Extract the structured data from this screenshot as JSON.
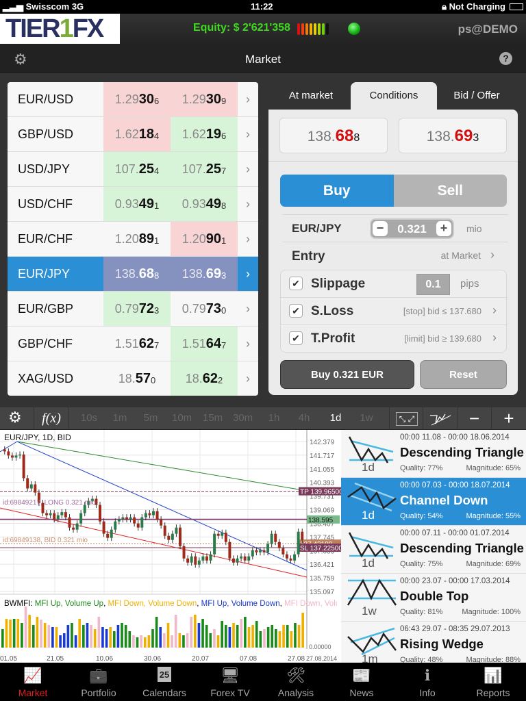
{
  "status": {
    "carrier": "Swisscom",
    "network": "3G",
    "time": "11:22",
    "battery": "Not Charging"
  },
  "header": {
    "logo": "TIER1FX",
    "equity": "Equity: $ 2'621'358",
    "user": "ps@DEMO",
    "meter_colors": [
      "#e01010",
      "#f04010",
      "#f07a10",
      "#f0b010",
      "#e0d010",
      "#b0d010",
      "#70d010",
      "#111"
    ],
    "connection": "connected"
  },
  "nav": {
    "title": "Market",
    "settings_icon": "gear-icon",
    "help_icon": "help-icon"
  },
  "quotes": [
    {
      "pair": "EUR/USD",
      "bid": [
        "1.29",
        "30",
        "6",
        "red"
      ],
      "ask": [
        "1.29",
        "30",
        "9",
        "red"
      ]
    },
    {
      "pair": "GBP/USD",
      "bid": [
        "1.62",
        "18",
        "4",
        "red"
      ],
      "ask": [
        "1.62",
        "19",
        "6",
        "green"
      ]
    },
    {
      "pair": "USD/JPY",
      "bid": [
        "107.",
        "25",
        "4",
        "green"
      ],
      "ask": [
        "107.",
        "25",
        "7",
        "green"
      ]
    },
    {
      "pair": "USD/CHF",
      "bid": [
        "0.93",
        "49",
        "1",
        "green"
      ],
      "ask": [
        "0.93",
        "49",
        "8",
        "green"
      ]
    },
    {
      "pair": "EUR/CHF",
      "bid": [
        "1.20",
        "89",
        "1",
        "none"
      ],
      "ask": [
        "1.20",
        "90",
        "1",
        "red"
      ]
    },
    {
      "pair": "EUR/JPY",
      "bid": [
        "138.",
        "68",
        "8",
        "sel"
      ],
      "ask": [
        "138.",
        "69",
        "3",
        "sel"
      ],
      "selected": true
    },
    {
      "pair": "EUR/GBP",
      "bid": [
        "0.79",
        "72",
        "3",
        "green"
      ],
      "ask": [
        "0.79",
        "73",
        "0",
        "none"
      ]
    },
    {
      "pair": "GBP/CHF",
      "bid": [
        "1.51",
        "62",
        "7",
        "none"
      ],
      "ask": [
        "1.51",
        "64",
        "7",
        "green"
      ]
    },
    {
      "pair": "XAG/USD",
      "bid": [
        "18.",
        "57",
        "0",
        "none"
      ],
      "ask": [
        "18.",
        "62",
        "2",
        "green"
      ]
    }
  ],
  "colors": {
    "red": "#f8d4d4",
    "green": "#d8f4d8",
    "none": "transparent",
    "sel": "#8592c0",
    "accent": "#2b8fd6"
  },
  "order": {
    "tabs": [
      "At market",
      "Conditions",
      "Bid / Offer"
    ],
    "active_tab": 1,
    "bid": {
      "pre": "138.",
      "big": "68",
      "sub": "8"
    },
    "ask": {
      "pre": "138.",
      "big": "69",
      "sub": "3"
    },
    "buy": "Buy",
    "sell": "Sell",
    "pair": "EUR/JPY",
    "amount": "0.321",
    "unit": "mio",
    "entry": "Entry",
    "entry_value": "at Market",
    "slippage": "Slippage",
    "slippage_value": "0.1",
    "slippage_unit": "pips",
    "sloss": "S.Loss",
    "sloss_value": "[stop] bid ≤ 137.680",
    "tprofit": "T.Profit",
    "tprofit_value": "[limit] bid ≥ 139.680",
    "submit": "Buy 0.321 EUR",
    "reset": "Reset"
  },
  "chart_toolbar": {
    "fx": "f(x)",
    "timeframes": [
      "10s",
      "1m",
      "5m",
      "10m",
      "15m",
      "30m",
      "1h",
      "4h",
      "1d",
      "1w"
    ],
    "active": "1d"
  },
  "chart_data": {
    "type": "candlestick",
    "title": "EUR/JPY, 1D, BID",
    "ylim": [
      135.097,
      142.379
    ],
    "yticks": [
      "142.379",
      "141.717",
      "141.055",
      "140.393",
      "139.731",
      "139.069",
      "138.407",
      "137.745",
      "137.083",
      "136.421",
      "135.759",
      "135.097"
    ],
    "xticks": [
      "01.05",
      "21.05",
      "10.06",
      "30.06",
      "20.07",
      "07.08",
      "27.08"
    ],
    "last_date": "27.08.2014",
    "closes": [
      141.9,
      141.7,
      141.6,
      141.7,
      141.75,
      140.6,
      140.1,
      140.3,
      139.9,
      139.4,
      138.9,
      138.8,
      138.9,
      138.6,
      138.8,
      138.95,
      138.7,
      138.2,
      138.1,
      138.4,
      138.9,
      139.3,
      139.5,
      139.6,
      139.3,
      138.5,
      137.9,
      137.7,
      138.1,
      138.5,
      138.6,
      138.7,
      138.6,
      138.7,
      138.4,
      138.2,
      138.7,
      138.9,
      138.8,
      139.0,
      138.6,
      138.3,
      137.8,
      137.6,
      137.9,
      138.2,
      137.3,
      136.7,
      136.5,
      136.8,
      136.4,
      136.6,
      136.8,
      136.6,
      136.9,
      137.9,
      137.8,
      137.95,
      137.5,
      136.7,
      136.5,
      136.7,
      136.8,
      136.6,
      136.8,
      137.1,
      137.0,
      137.1,
      137.0,
      137.4,
      137.9,
      137.5,
      137.2,
      136.9,
      136.7,
      136.6,
      136.9,
      138.0,
      137.6
    ],
    "levels": [
      {
        "label": "TP 139.96500",
        "value": 139.965,
        "color": "#7a3a5a"
      },
      {
        "label": "138.595",
        "value": 138.595,
        "color": "#8a4a7a"
      },
      {
        "label": "137.42100",
        "value": 137.421,
        "color": "#c08060"
      },
      {
        "label": "SL 137.22500",
        "value": 137.225,
        "color": "#7a3a5a"
      }
    ],
    "orders": [
      "id:69849217, LONG 0.321 mio",
      "id:69849138, BID 0.321 mio"
    ],
    "indicator": {
      "name": "BWMFI:",
      "legend": [
        [
          "MFI Up, Volume Up",
          "#1a8a1a"
        ],
        [
          "MFI Down, Volume Down",
          "#f0b000"
        ],
        [
          "MFI Up, Volume Down",
          "#1a3ad0"
        ],
        [
          "MFI Down, Volume Up",
          "#f0b8c8"
        ]
      ],
      "zero": "0.00000",
      "bars": "gyygygpygypypbybbbgbygbpypbbygbgggpgpyyggbpyppygppybgggpyggbygpgyyggpgggyygygyy",
      "heights": [
        0.45,
        0.7,
        0.68,
        0.7,
        0.7,
        0.6,
        1.0,
        0.8,
        0.55,
        0.75,
        0.68,
        0.6,
        0.55,
        0.5,
        0.5,
        0.3,
        0.35,
        0.55,
        0.6,
        0.3,
        0.7,
        0.55,
        0.6,
        0.55,
        0.45,
        0.75,
        0.5,
        0.45,
        0.5,
        0.4,
        0.55,
        0.6,
        0.55,
        0.4,
        0.3,
        0.25,
        0.3,
        0.25,
        0.3,
        0.45,
        0.75,
        0.5,
        0.35,
        0.6,
        0.3,
        0.8,
        0.35,
        0.3,
        0.35,
        0.75,
        0.8,
        0.6,
        0.7,
        0.55,
        0.35,
        0.45,
        0.3,
        0.65,
        0.55,
        0.5,
        0.6,
        0.55,
        0.7,
        0.75,
        0.5,
        0.55,
        0.65,
        0.4,
        0.45,
        0.5,
        0.55,
        0.45,
        0.4,
        0.55,
        0.55,
        0.4,
        0.6,
        0.55,
        0.85
      ]
    }
  },
  "patterns": [
    {
      "dates": "00:00 11.08 - 00:00 18.06.2014",
      "name": "Descending Triangle",
      "tf": "1d",
      "quality": "Quality: 77%",
      "magnitude": "Magnitude: 65%",
      "icon": "descending-triangle"
    },
    {
      "dates": "00:00 07.03 - 00:00 18.07.2014",
      "name": "Channel Down",
      "tf": "1d",
      "quality": "Quality: 54%",
      "magnitude": "Magnitude: 55%",
      "icon": "channel-down",
      "selected": true
    },
    {
      "dates": "00:00 07.11 - 00:00 01.07.2014",
      "name": "Descending Triangle",
      "tf": "1d",
      "quality": "Quality: 75%",
      "magnitude": "Magnitude: 69%",
      "icon": "descending-triangle"
    },
    {
      "dates": "00:00 23.07 - 00:00 17.03.2014",
      "name": "Double Top",
      "tf": "1w",
      "quality": "Quality: 81%",
      "magnitude": "Magnitude: 100%",
      "icon": "double-top"
    },
    {
      "dates": "06:43 29.07 - 08:35 29.07.2013",
      "name": "Rising Wedge",
      "tf": "1m",
      "quality": "Quality: 48%",
      "magnitude": "Magnitude: 88%",
      "icon": "rising-wedge"
    }
  ],
  "tabbar": {
    "items": [
      "Market",
      "Portfolio",
      "Calendars",
      "Forex TV",
      "Analysis",
      "News",
      "Info",
      "Reports"
    ],
    "active": 0,
    "calendar_day": "25"
  }
}
